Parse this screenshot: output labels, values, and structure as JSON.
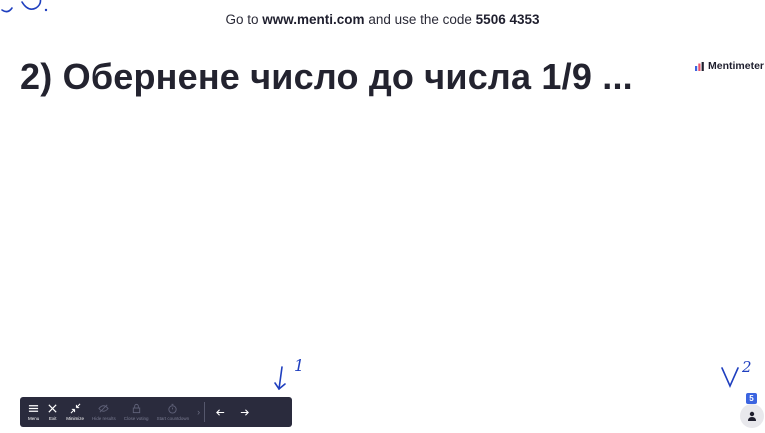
{
  "header": {
    "prefix": "Go to",
    "url": "www.menti.com",
    "middle": "and use the code",
    "code": "5506 4353"
  },
  "slide": {
    "title": "2) Обернене число до числа 1/9 ..."
  },
  "brand": {
    "name": "Mentimeter"
  },
  "toolbar": {
    "items": [
      {
        "label": "Menu",
        "icon": "hamburger-icon"
      },
      {
        "label": "Exit",
        "icon": "close-icon"
      },
      {
        "label": "Minimize",
        "icon": "minimize-icon"
      },
      {
        "label": "Hide results",
        "icon": "eye-off-icon"
      },
      {
        "label": "Close voting",
        "icon": "lock-icon"
      },
      {
        "label": "Start countdown",
        "icon": "timer-icon"
      }
    ],
    "prev_icon": "arrow-left-icon",
    "next_icon": "arrow-right-icon"
  },
  "participants": {
    "count": "5"
  },
  "annotations": {
    "mark1": "1",
    "mark2": "2"
  },
  "colors": {
    "toolbar_bg": "#2a2b3d",
    "ink": "#1f3fbf",
    "badge": "#3b64e0"
  }
}
